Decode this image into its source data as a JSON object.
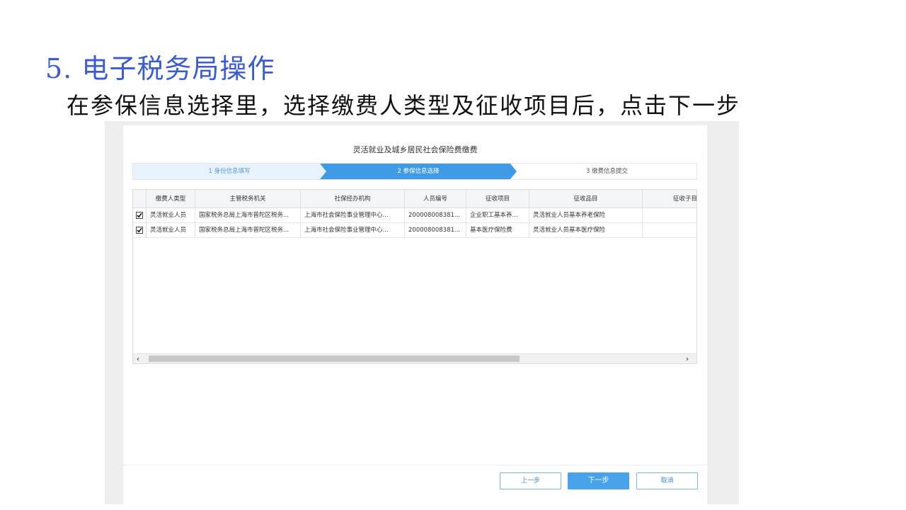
{
  "slide": {
    "title": "5. 电子税务局操作",
    "subtitle": "在参保信息选择里，选择缴费人类型及征收项目后，点击下一步"
  },
  "dialog": {
    "title": "灵活就业及城乡居民社会保险费缴费",
    "steps": [
      {
        "label": "1 身份信息填写",
        "state": "completed"
      },
      {
        "label": "2 参保信息选择",
        "state": "active"
      },
      {
        "label": "3 缴费信息提交",
        "state": "pending"
      }
    ],
    "table": {
      "columns": [
        "缴费人类型",
        "主管税务机关",
        "社保经办机构",
        "人员编号",
        "征收项目",
        "征收品目",
        "征收子目"
      ],
      "rows": [
        {
          "checked": true,
          "cells": [
            "灵活就业人员",
            "国家税务总局上海市普陀区税务...",
            "上海市社会保险事业管理中心...",
            "200008008381...",
            "企业职工基本养...",
            "灵活就业人员基本养老保险",
            ""
          ]
        },
        {
          "checked": true,
          "cells": [
            "灵活就业人员",
            "国家税务总局上海市普陀区税务...",
            "上海市社会保险事业管理中心...",
            "200008008381...",
            "基本医疗保险费",
            "灵活就业人员基本医疗保险",
            ""
          ]
        }
      ],
      "scroll_left_icon": "‹",
      "scroll_right_icon": "›"
    },
    "buttons": {
      "prev": "上一步",
      "next": "下一步",
      "cancel": "取消"
    }
  },
  "colors": {
    "title_blue": "#3a5bd6",
    "accent_blue": "#49a3ea",
    "step_active": "#3f9ae8",
    "step_done_bg": "#e7f2fc"
  }
}
